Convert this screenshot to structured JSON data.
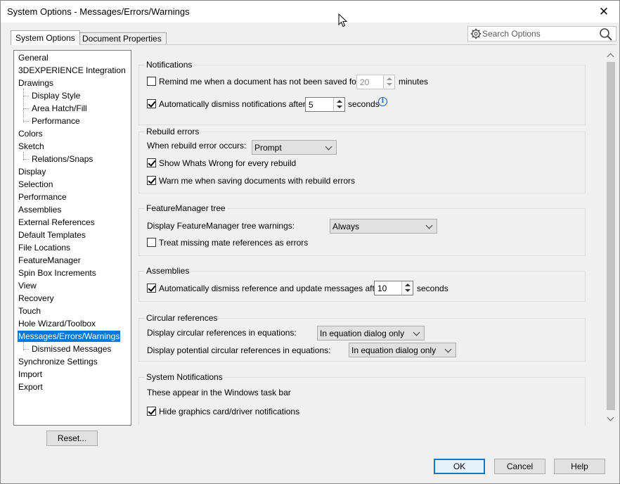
{
  "window": {
    "title": "System Options - Messages/Errors/Warnings",
    "close_glyph": "✕"
  },
  "tabs": [
    {
      "label": "System Options",
      "active": true
    },
    {
      "label": "Document Properties",
      "active": false
    }
  ],
  "search": {
    "placeholder": "Search Options",
    "value": ""
  },
  "tree": {
    "items": [
      {
        "label": "General",
        "level": 0
      },
      {
        "label": "3DEXPERIENCE Integration",
        "level": 0
      },
      {
        "label": "Drawings",
        "level": 0
      },
      {
        "label": "Display Style",
        "level": 1
      },
      {
        "label": "Area Hatch/Fill",
        "level": 1
      },
      {
        "label": "Performance",
        "level": 1
      },
      {
        "label": "Colors",
        "level": 0
      },
      {
        "label": "Sketch",
        "level": 0
      },
      {
        "label": "Relations/Snaps",
        "level": 1
      },
      {
        "label": "Display",
        "level": 0
      },
      {
        "label": "Selection",
        "level": 0
      },
      {
        "label": "Performance",
        "level": 0
      },
      {
        "label": "Assemblies",
        "level": 0
      },
      {
        "label": "External References",
        "level": 0
      },
      {
        "label": "Default Templates",
        "level": 0
      },
      {
        "label": "File Locations",
        "level": 0
      },
      {
        "label": "FeatureManager",
        "level": 0
      },
      {
        "label": "Spin Box Increments",
        "level": 0
      },
      {
        "label": "View",
        "level": 0
      },
      {
        "label": "Recovery",
        "level": 0
      },
      {
        "label": "Touch",
        "level": 0
      },
      {
        "label": "Hole Wizard/Toolbox",
        "level": 0
      },
      {
        "label": "Messages/Errors/Warnings",
        "level": 0,
        "selected": true
      },
      {
        "label": "Dismissed Messages",
        "level": 1
      },
      {
        "label": "Synchronize Settings",
        "level": 0
      },
      {
        "label": "Import",
        "level": 0
      },
      {
        "label": "Export",
        "level": 0
      }
    ]
  },
  "reset_label": "Reset...",
  "notifications": {
    "title": "Notifications",
    "remind": {
      "label": "Remind me when a document has not been saved for:",
      "checked": false,
      "value": "20",
      "unit": "minutes"
    },
    "dismiss": {
      "label": "Automatically dismiss notifications after:",
      "checked": true,
      "value": "5",
      "unit": "seconds"
    }
  },
  "rebuild": {
    "title": "Rebuild errors",
    "when_label": "When rebuild error occurs:",
    "when_value": "Prompt",
    "show_whats_wrong": {
      "label": "Show Whats Wrong for every rebuild",
      "checked": true
    },
    "warn_saving": {
      "label": "Warn me when saving documents with rebuild errors",
      "checked": true
    }
  },
  "featuremanager": {
    "title": "FeatureManager tree",
    "display_label": "Display FeatureManager tree warnings:",
    "display_value": "Always",
    "treat_missing": {
      "label": "Treat missing mate references as errors",
      "checked": false
    }
  },
  "assemblies": {
    "title": "Assemblies",
    "dismiss": {
      "label": "Automatically dismiss reference and update messages after:",
      "checked": true,
      "value": "10",
      "unit": "seconds"
    }
  },
  "circular": {
    "title": "Circular references",
    "display_label": "Display circular references in equations:",
    "display_value": "In equation dialog only",
    "potential_label": "Display potential circular references in equations:",
    "potential_value": "In equation dialog only"
  },
  "system_notifications": {
    "title": "System Notifications",
    "note": "These appear in the Windows task bar",
    "hide_graphics": {
      "label": "Hide graphics card/driver notifications",
      "checked": true
    }
  },
  "footer": {
    "ok": "OK",
    "cancel": "Cancel",
    "help": "Help"
  }
}
